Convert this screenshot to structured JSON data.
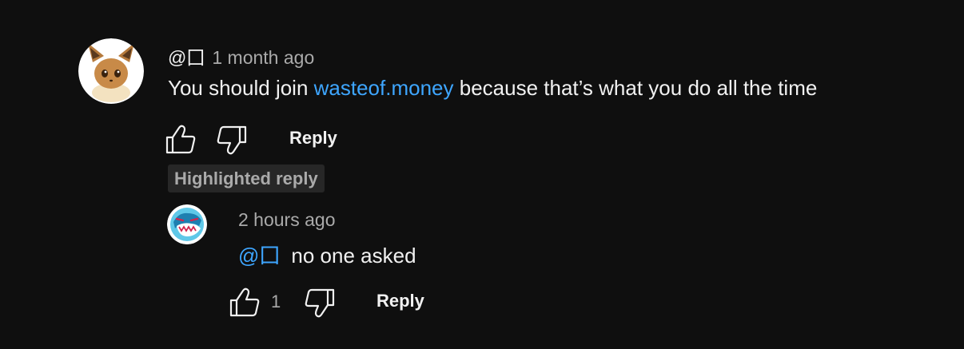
{
  "comment": {
    "author": "@囗",
    "timestamp": "1 month ago",
    "text_before": "You should join ",
    "link": "wasteof.money",
    "text_after": " because that’s what you do all the time",
    "reply_label": "Reply",
    "avatar_icon": "eevee-avatar"
  },
  "highlight_badge": "Highlighted reply",
  "reply": {
    "timestamp": "2 hours ago",
    "mention": "@囗",
    "text": "no one asked",
    "like_count": "1",
    "reply_label": "Reply",
    "avatar_icon": "mrbeast-avatar"
  },
  "colors": {
    "background": "#0f0f0f",
    "text": "#f1f1f1",
    "secondary": "#aaaaaa",
    "link": "#3ea6ff",
    "badge_bg": "#272727"
  }
}
